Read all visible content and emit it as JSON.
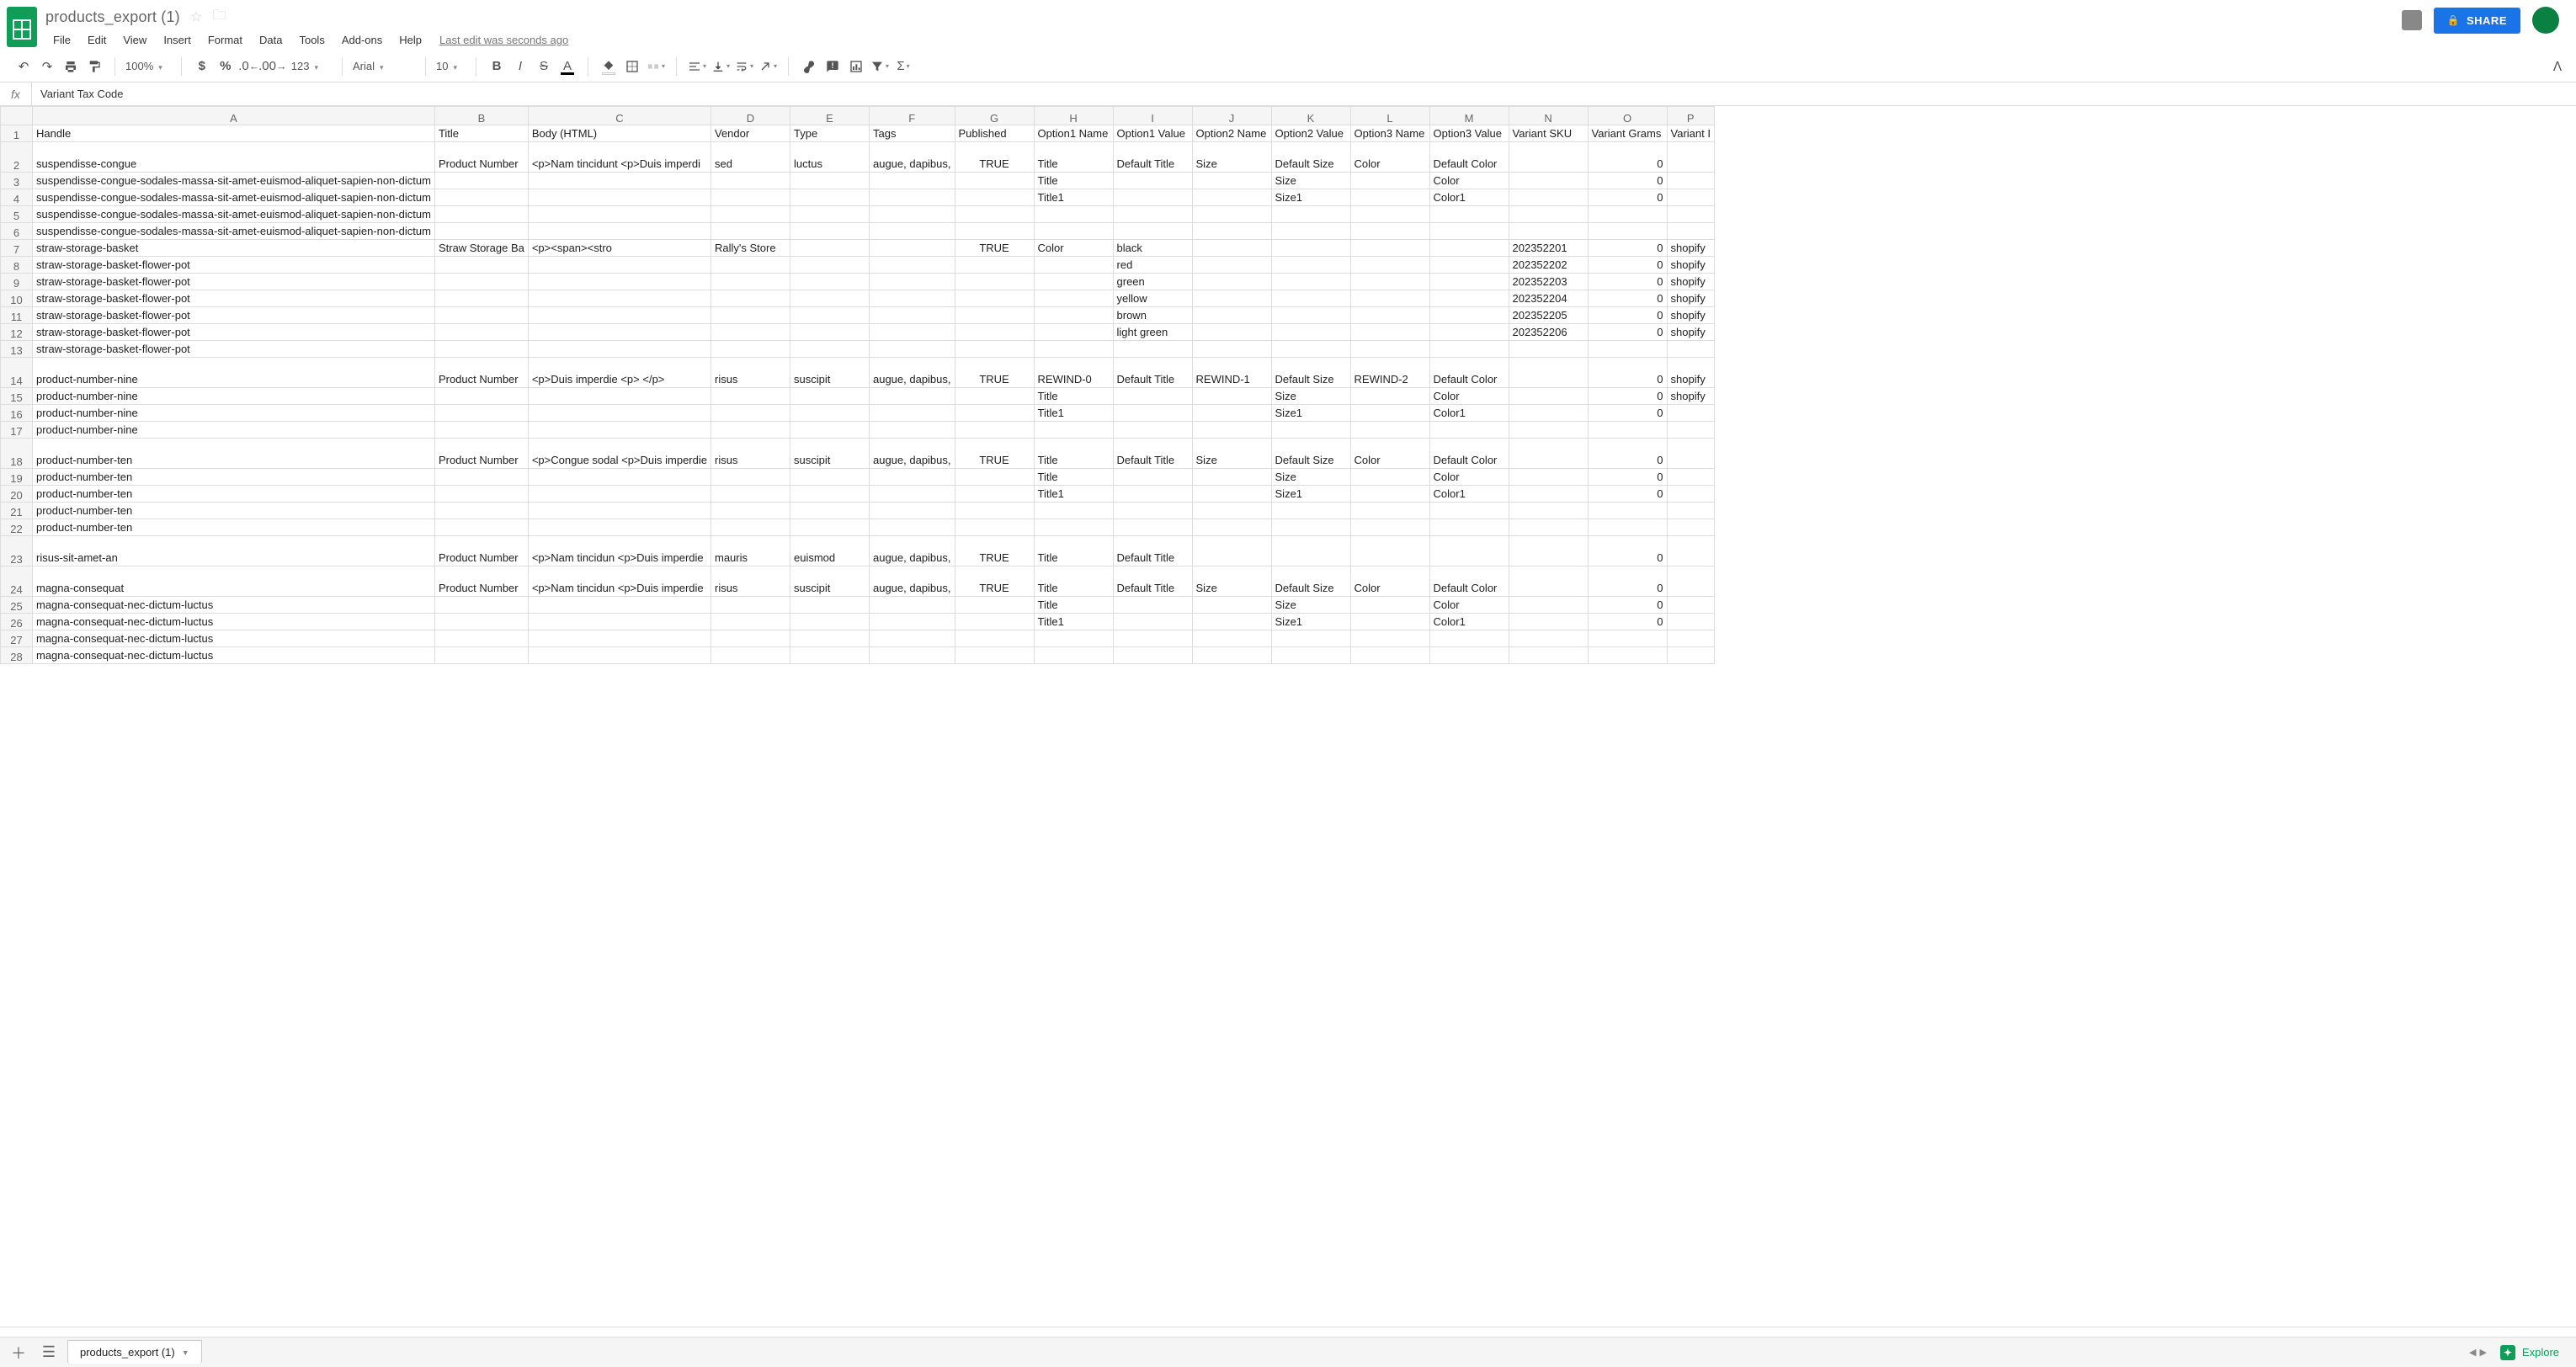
{
  "doc": {
    "title": "products_export (1)"
  },
  "menubar": {
    "items": [
      "File",
      "Edit",
      "View",
      "Insert",
      "Format",
      "Data",
      "Tools",
      "Add-ons",
      "Help"
    ],
    "last_edit": "Last edit was seconds ago"
  },
  "share": {
    "label": "SHARE"
  },
  "toolbar": {
    "zoom": "100%",
    "font": "Arial",
    "font_size": "10",
    "number_fmt": "123"
  },
  "formula": {
    "fx": "fx",
    "value": "Variant Tax Code"
  },
  "columns": [
    {
      "letter": "A",
      "width": 94
    },
    {
      "letter": "B",
      "width": 94
    },
    {
      "letter": "C",
      "width": 94
    },
    {
      "letter": "D",
      "width": 94
    },
    {
      "letter": "E",
      "width": 94
    },
    {
      "letter": "F",
      "width": 94
    },
    {
      "letter": "G",
      "width": 94
    },
    {
      "letter": "H",
      "width": 94
    },
    {
      "letter": "I",
      "width": 94
    },
    {
      "letter": "J",
      "width": 94
    },
    {
      "letter": "K",
      "width": 94
    },
    {
      "letter": "L",
      "width": 94
    },
    {
      "letter": "M",
      "width": 94
    },
    {
      "letter": "N",
      "width": 94
    },
    {
      "letter": "O",
      "width": 94
    },
    {
      "letter": "P",
      "width": 50
    }
  ],
  "header_row": [
    "Handle",
    "Title",
    "Body (HTML)",
    "Vendor",
    "Type",
    "Tags",
    "Published",
    "Option1 Name",
    "Option1 Value",
    "Option2 Name",
    "Option2 Value",
    "Option3 Name",
    "Option3 Value",
    "Variant SKU",
    "Variant Grams",
    "Variant I"
  ],
  "rows": [
    {
      "n": 2,
      "tall": true,
      "cells": [
        "suspendisse-congue",
        "Product Number",
        "<p>Nam tincidunt\n<p>Duis imperdi",
        "sed",
        "luctus",
        "augue, dapibus,",
        "TRUE",
        "Title",
        "Default Title",
        "Size",
        "Default Size",
        "Color",
        "Default Color",
        "",
        "0",
        ""
      ]
    },
    {
      "n": 3,
      "cells": [
        "suspendisse-congue-sodales-massa-sit-amet-euismod-aliquet-sapien-non-dictum",
        "",
        "",
        "",
        "",
        "",
        "",
        "Title",
        "",
        "",
        "Size",
        "",
        "Color",
        "",
        "0",
        ""
      ]
    },
    {
      "n": 4,
      "cells": [
        "suspendisse-congue-sodales-massa-sit-amet-euismod-aliquet-sapien-non-dictum",
        "",
        "",
        "",
        "",
        "",
        "",
        "Title1",
        "",
        "",
        "Size1",
        "",
        "Color1",
        "",
        "0",
        ""
      ]
    },
    {
      "n": 5,
      "cells": [
        "suspendisse-congue-sodales-massa-sit-amet-euismod-aliquet-sapien-non-dictum",
        "",
        "",
        "",
        "",
        "",
        "",
        "",
        "",
        "",
        "",
        "",
        "",
        "",
        "",
        ""
      ]
    },
    {
      "n": 6,
      "cells": [
        "suspendisse-congue-sodales-massa-sit-amet-euismod-aliquet-sapien-non-dictum",
        "",
        "",
        "",
        "",
        "",
        "",
        "",
        "",
        "",
        "",
        "",
        "",
        "",
        "",
        ""
      ]
    },
    {
      "n": 7,
      "cells": [
        "straw-storage-basket",
        "Straw Storage Ba",
        "<p><span><stro",
        "Rally's Store",
        "",
        "",
        "TRUE",
        "Color",
        "black",
        "",
        "",
        "",
        "",
        "202352201",
        "0",
        "shopify"
      ]
    },
    {
      "n": 8,
      "cells": [
        "straw-storage-basket-flower-pot",
        "",
        "",
        "",
        "",
        "",
        "",
        "",
        "red",
        "",
        "",
        "",
        "",
        "202352202",
        "0",
        "shopify"
      ]
    },
    {
      "n": 9,
      "cells": [
        "straw-storage-basket-flower-pot",
        "",
        "",
        "",
        "",
        "",
        "",
        "",
        "green",
        "",
        "",
        "",
        "",
        "202352203",
        "0",
        "shopify"
      ]
    },
    {
      "n": 10,
      "cells": [
        "straw-storage-basket-flower-pot",
        "",
        "",
        "",
        "",
        "",
        "",
        "",
        "yellow",
        "",
        "",
        "",
        "",
        "202352204",
        "0",
        "shopify"
      ]
    },
    {
      "n": 11,
      "cells": [
        "straw-storage-basket-flower-pot",
        "",
        "",
        "",
        "",
        "",
        "",
        "",
        "brown",
        "",
        "",
        "",
        "",
        "202352205",
        "0",
        "shopify"
      ]
    },
    {
      "n": 12,
      "cells": [
        "straw-storage-basket-flower-pot",
        "",
        "",
        "",
        "",
        "",
        "",
        "",
        "light green",
        "",
        "",
        "",
        "",
        "202352206",
        "0",
        "shopify"
      ]
    },
    {
      "n": 13,
      "cells": [
        "straw-storage-basket-flower-pot",
        "",
        "",
        "",
        "",
        "",
        "",
        "",
        "",
        "",
        "",
        "",
        "",
        "",
        "",
        ""
      ]
    },
    {
      "n": 14,
      "tall": true,
      "cells": [
        "product-number-nine",
        "Product Number",
        "<p>Duis imperdie\n<p> </p>",
        "risus",
        "suscipit",
        "augue, dapibus,",
        "TRUE",
        "REWIND-0",
        "Default Title",
        "REWIND-1",
        "Default Size",
        "REWIND-2",
        "Default Color",
        "",
        "0",
        "shopify"
      ]
    },
    {
      "n": 15,
      "cells": [
        "product-number-nine",
        "",
        "",
        "",
        "",
        "",
        "",
        "Title",
        "",
        "",
        "Size",
        "",
        "Color",
        "",
        "0",
        "shopify"
      ]
    },
    {
      "n": 16,
      "cells": [
        "product-number-nine",
        "",
        "",
        "",
        "",
        "",
        "",
        "Title1",
        "",
        "",
        "Size1",
        "",
        "Color1",
        "",
        "0",
        ""
      ]
    },
    {
      "n": 17,
      "cells": [
        "product-number-nine",
        "",
        "",
        "",
        "",
        "",
        "",
        "",
        "",
        "",
        "",
        "",
        "",
        "",
        "",
        ""
      ]
    },
    {
      "n": 18,
      "tall": true,
      "cells": [
        "product-number-ten",
        "Product Number",
        "<p>Congue sodal\n<p>Duis imperdie",
        "risus",
        "suscipit",
        "augue, dapibus,",
        "TRUE",
        "Title",
        "Default Title",
        "Size",
        "Default Size",
        "Color",
        "Default Color",
        "",
        "0",
        ""
      ]
    },
    {
      "n": 19,
      "cells": [
        "product-number-ten",
        "",
        "",
        "",
        "",
        "",
        "",
        "Title",
        "",
        "",
        "Size",
        "",
        "Color",
        "",
        "0",
        ""
      ]
    },
    {
      "n": 20,
      "cells": [
        "product-number-ten",
        "",
        "",
        "",
        "",
        "",
        "",
        "Title1",
        "",
        "",
        "Size1",
        "",
        "Color1",
        "",
        "0",
        ""
      ]
    },
    {
      "n": 21,
      "cells": [
        "product-number-ten",
        "",
        "",
        "",
        "",
        "",
        "",
        "",
        "",
        "",
        "",
        "",
        "",
        "",
        "",
        ""
      ]
    },
    {
      "n": 22,
      "cells": [
        "product-number-ten",
        "",
        "",
        "",
        "",
        "",
        "",
        "",
        "",
        "",
        "",
        "",
        "",
        "",
        "",
        ""
      ]
    },
    {
      "n": 23,
      "tall": true,
      "cells": [
        "risus-sit-amet-an",
        "Product Number",
        "<p>Nam tincidun\n<p>Duis imperdie",
        "mauris",
        "euismod",
        "augue, dapibus,",
        "TRUE",
        "Title",
        "Default Title",
        "",
        "",
        "",
        "",
        "",
        "0",
        ""
      ]
    },
    {
      "n": 24,
      "tall": true,
      "cells": [
        "magna-consequat",
        "Product Number",
        "<p>Nam tincidun\n<p>Duis imperdie",
        "risus",
        "suscipit",
        "augue, dapibus,",
        "TRUE",
        "Title",
        "Default Title",
        "Size",
        "Default Size",
        "Color",
        "Default Color",
        "",
        "0",
        ""
      ]
    },
    {
      "n": 25,
      "cells": [
        "magna-consequat-nec-dictum-luctus",
        "",
        "",
        "",
        "",
        "",
        "",
        "Title",
        "",
        "",
        "Size",
        "",
        "Color",
        "",
        "0",
        ""
      ]
    },
    {
      "n": 26,
      "cells": [
        "magna-consequat-nec-dictum-luctus",
        "",
        "",
        "",
        "",
        "",
        "",
        "Title1",
        "",
        "",
        "Size1",
        "",
        "Color1",
        "",
        "0",
        ""
      ]
    },
    {
      "n": 27,
      "cells": [
        "magna-consequat-nec-dictum-luctus",
        "",
        "",
        "",
        "",
        "",
        "",
        "",
        "",
        "",
        "",
        "",
        "",
        "",
        "",
        ""
      ]
    },
    {
      "n": 28,
      "cells": [
        "magna-consequat-nec-dictum-luctus",
        "",
        "",
        "",
        "",
        "",
        "",
        "",
        "",
        "",
        "",
        "",
        "",
        "",
        "",
        ""
      ]
    }
  ],
  "sheetbar": {
    "tab": "products_export (1)",
    "explore": "Explore"
  },
  "center_cols": [
    6
  ],
  "right_cols": [
    14
  ]
}
